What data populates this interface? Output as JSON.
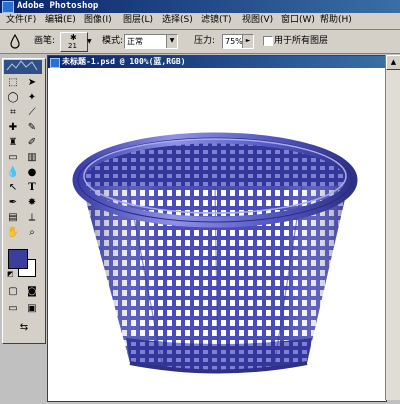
{
  "app": {
    "title": "Adobe Photoshop"
  },
  "menu": [
    "文件(F)",
    "编辑(E)",
    "图像(I)",
    "图层(L)",
    "选择(S)",
    "滤镜(T)",
    "视图(V)",
    "窗口(W)",
    "帮助(H)"
  ],
  "options": {
    "brush_label": "画笔:",
    "brush_size": "21",
    "mode_label": "模式:",
    "mode_value": "正常",
    "pressure_label": "压力:",
    "pressure_value": "75%",
    "all_layers_label": "用于所有图层",
    "all_layers_checked": false
  },
  "document": {
    "title": "未标题-1.psd @ 100%(蓝,RGB)"
  },
  "colors": {
    "foreground": "#3a3f9e",
    "background": "#ffffff",
    "basket_main": "#5558c2",
    "basket_dark": "#2f3187",
    "basket_light": "#8f92e6"
  },
  "tools": [
    "marquee-icon",
    "move-icon",
    "lasso-icon",
    "magic-wand-icon",
    "crop-icon",
    "slice-icon",
    "healing-brush-icon",
    "brush-icon",
    "clone-stamp-icon",
    "history-brush-icon",
    "eraser-icon",
    "gradient-icon",
    "blur-icon",
    "dodge-icon",
    "path-selection-icon",
    "type-icon",
    "pen-icon",
    "custom-shape-icon",
    "notes-icon",
    "eyedropper-icon",
    "hand-icon",
    "zoom-icon"
  ]
}
